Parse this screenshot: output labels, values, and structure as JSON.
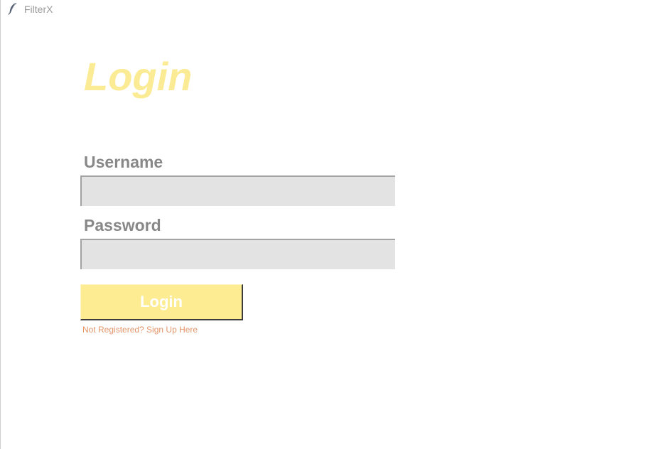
{
  "window": {
    "title": "FilterX",
    "icon": "feather-icon"
  },
  "login_form": {
    "heading": "Login",
    "username_label": "Username",
    "username_value": "",
    "password_label": "Password",
    "password_value": "",
    "submit_label": "Login",
    "signup_link": "Not Registered? Sign Up Here"
  },
  "colors": {
    "heading": "#fbeb94",
    "label": "#888888",
    "input_background": "#e3e3e3",
    "button_background": "#fdec92",
    "button_text": "#ffffff",
    "link": "#e2956a"
  }
}
